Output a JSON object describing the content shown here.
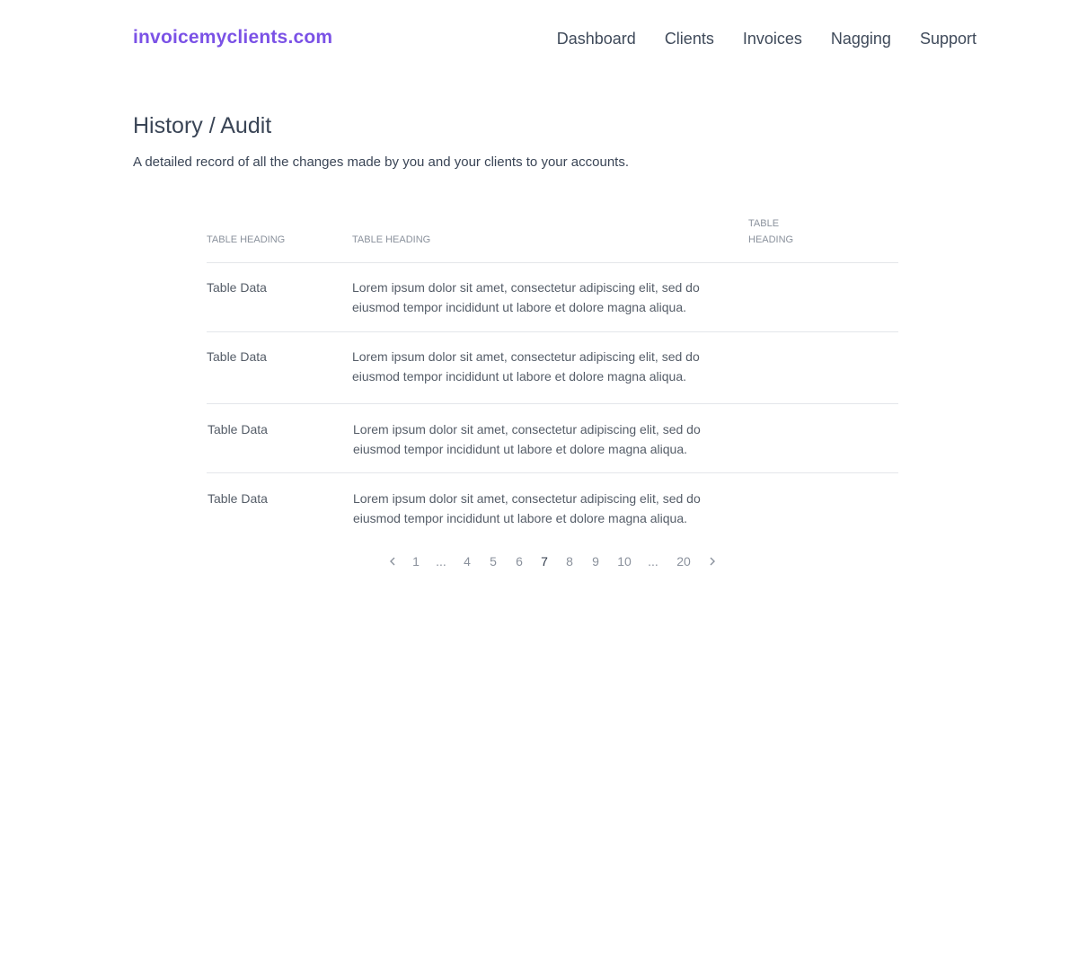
{
  "header": {
    "brand": "invoicemyclients.com",
    "nav": [
      "Dashboard",
      "Clients",
      "Invoices",
      "Nagging",
      "Support"
    ]
  },
  "page": {
    "title": "History / Audit",
    "subtitle": "A detailed record of all the changes made by you and your clients to your accounts."
  },
  "table": {
    "headers": [
      "TABLE HEADING",
      "TABLE HEADING",
      "TABLE HEADING"
    ],
    "rows": [
      {
        "col1": "Table Data",
        "col2": "Lorem ipsum dolor sit amet, consectetur adipiscing elit, sed do eiusmod tempor incididunt ut labore et dolore magna aliqua.",
        "col3": ""
      },
      {
        "col1": "Table Data",
        "col2": "Lorem ipsum dolor sit amet, consectetur adipiscing elit, sed do eiusmod tempor incididunt ut labore et dolore magna aliqua.",
        "col3": ""
      },
      {
        "col1": "Table Data",
        "col2": "Lorem ipsum dolor sit amet, consectetur adipiscing elit, sed do eiusmod tempor incididunt ut labore et dolore magna aliqua.",
        "col3": ""
      },
      {
        "col1": "Table Data",
        "col2": "Lorem ipsum dolor sit amet, consectetur adipiscing elit, sed do eiusmod tempor incididunt ut labore et dolore magna aliqua.",
        "col3": ""
      }
    ]
  },
  "pagination": {
    "pages": [
      "1",
      "...",
      "4",
      "5",
      "6",
      "7",
      "8",
      "9",
      "10",
      "...",
      "20"
    ],
    "current": "7",
    "prev_icon": "chevron-left-icon",
    "next_icon": "chevron-right-icon"
  },
  "colors": {
    "brand": "#7b52e6",
    "text": "#3a4556",
    "muted": "#8a919c",
    "divider": "#e4e6ea"
  }
}
